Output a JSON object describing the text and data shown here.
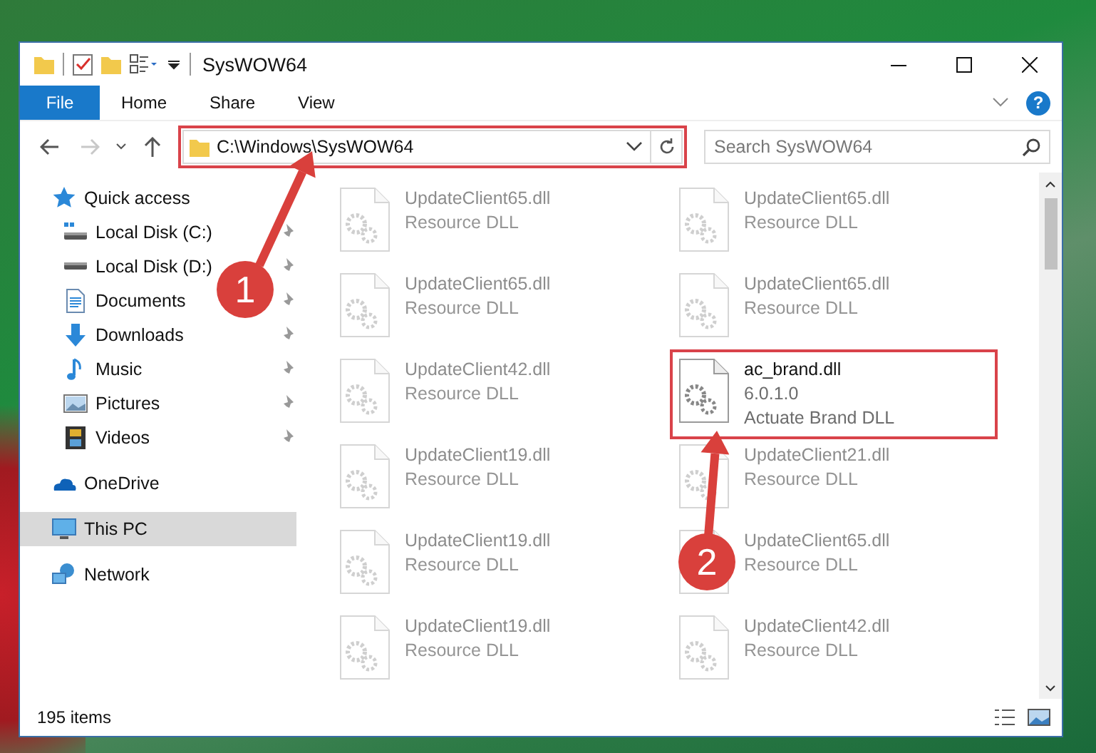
{
  "window": {
    "title": "SysWOW64"
  },
  "ribbon": {
    "file_menu": "File",
    "tabs": [
      {
        "label": "Home",
        "selected": false
      },
      {
        "label": "Share",
        "selected": false
      },
      {
        "label": "View",
        "selected": false
      }
    ],
    "help": "?"
  },
  "navigation": {
    "back_enabled": true,
    "forward_enabled": false
  },
  "address_bar": {
    "path": "C:\\Windows\\SysWOW64",
    "highlighted": true
  },
  "search": {
    "placeholder": "Search SysWOW64"
  },
  "sidebar": {
    "items": [
      {
        "label": "Quick access",
        "kind": "star",
        "selected": false,
        "children": [
          {
            "label": "Local Disk (C:)",
            "kind": "systemdrive",
            "pinned": true,
            "selected": false
          },
          {
            "label": "Local Disk (D:)",
            "kind": "drive",
            "pinned": true,
            "selected": false
          },
          {
            "label": "Documents",
            "kind": "document",
            "pinned": true,
            "selected": false
          },
          {
            "label": "Downloads",
            "kind": "download",
            "pinned": true,
            "selected": false
          },
          {
            "label": "Music",
            "kind": "music",
            "pinned": true,
            "selected": false
          },
          {
            "label": "Pictures",
            "kind": "picture",
            "pinned": true,
            "selected": false
          },
          {
            "label": "Videos",
            "kind": "video",
            "pinned": true,
            "selected": false
          }
        ]
      },
      {
        "label": "OneDrive",
        "kind": "cloud",
        "selected": false
      },
      {
        "label": "This PC",
        "kind": "computer",
        "selected": true
      },
      {
        "label": "Network",
        "kind": "network",
        "selected": false
      }
    ]
  },
  "files": [
    {
      "name": "UpdateClient65.dll",
      "details": [
        "Resource DLL"
      ],
      "faded": true,
      "highlighted": false
    },
    {
      "name": "UpdateClient65.dll",
      "details": [
        "Resource DLL"
      ],
      "faded": true,
      "highlighted": false
    },
    {
      "name": "UpdateClient65.dll",
      "details": [
        "Resource DLL"
      ],
      "faded": true,
      "highlighted": false
    },
    {
      "name": "UpdateClient65.dll",
      "details": [
        "Resource DLL"
      ],
      "faded": true,
      "highlighted": false
    },
    {
      "name": "UpdateClient42.dll",
      "details": [
        "Resource DLL"
      ],
      "faded": true,
      "highlighted": false
    },
    {
      "name": "ac_brand.dll",
      "details": [
        "6.0.1.0",
        "Actuate Brand DLL"
      ],
      "faded": false,
      "highlighted": true
    },
    {
      "name": "UpdateClient19.dll",
      "details": [
        "Resource DLL"
      ],
      "faded": true,
      "highlighted": false
    },
    {
      "name": "UpdateClient21.dll",
      "details": [
        "Resource DLL"
      ],
      "faded": true,
      "highlighted": false
    },
    {
      "name": "UpdateClient19.dll",
      "details": [
        "Resource DLL"
      ],
      "faded": true,
      "highlighted": false
    },
    {
      "name": "UpdateClient65.dll",
      "details": [
        "Resource DLL"
      ],
      "faded": true,
      "highlighted": false
    },
    {
      "name": "UpdateClient19.dll",
      "details": [
        "Resource DLL"
      ],
      "faded": true,
      "highlighted": false
    },
    {
      "name": "UpdateClient42.dll",
      "details": [
        "Resource DLL"
      ],
      "faded": true,
      "highlighted": false
    }
  ],
  "status_bar": {
    "item_count": "195 items"
  },
  "annotations": [
    {
      "number": "1"
    },
    {
      "number": "2"
    }
  ]
}
